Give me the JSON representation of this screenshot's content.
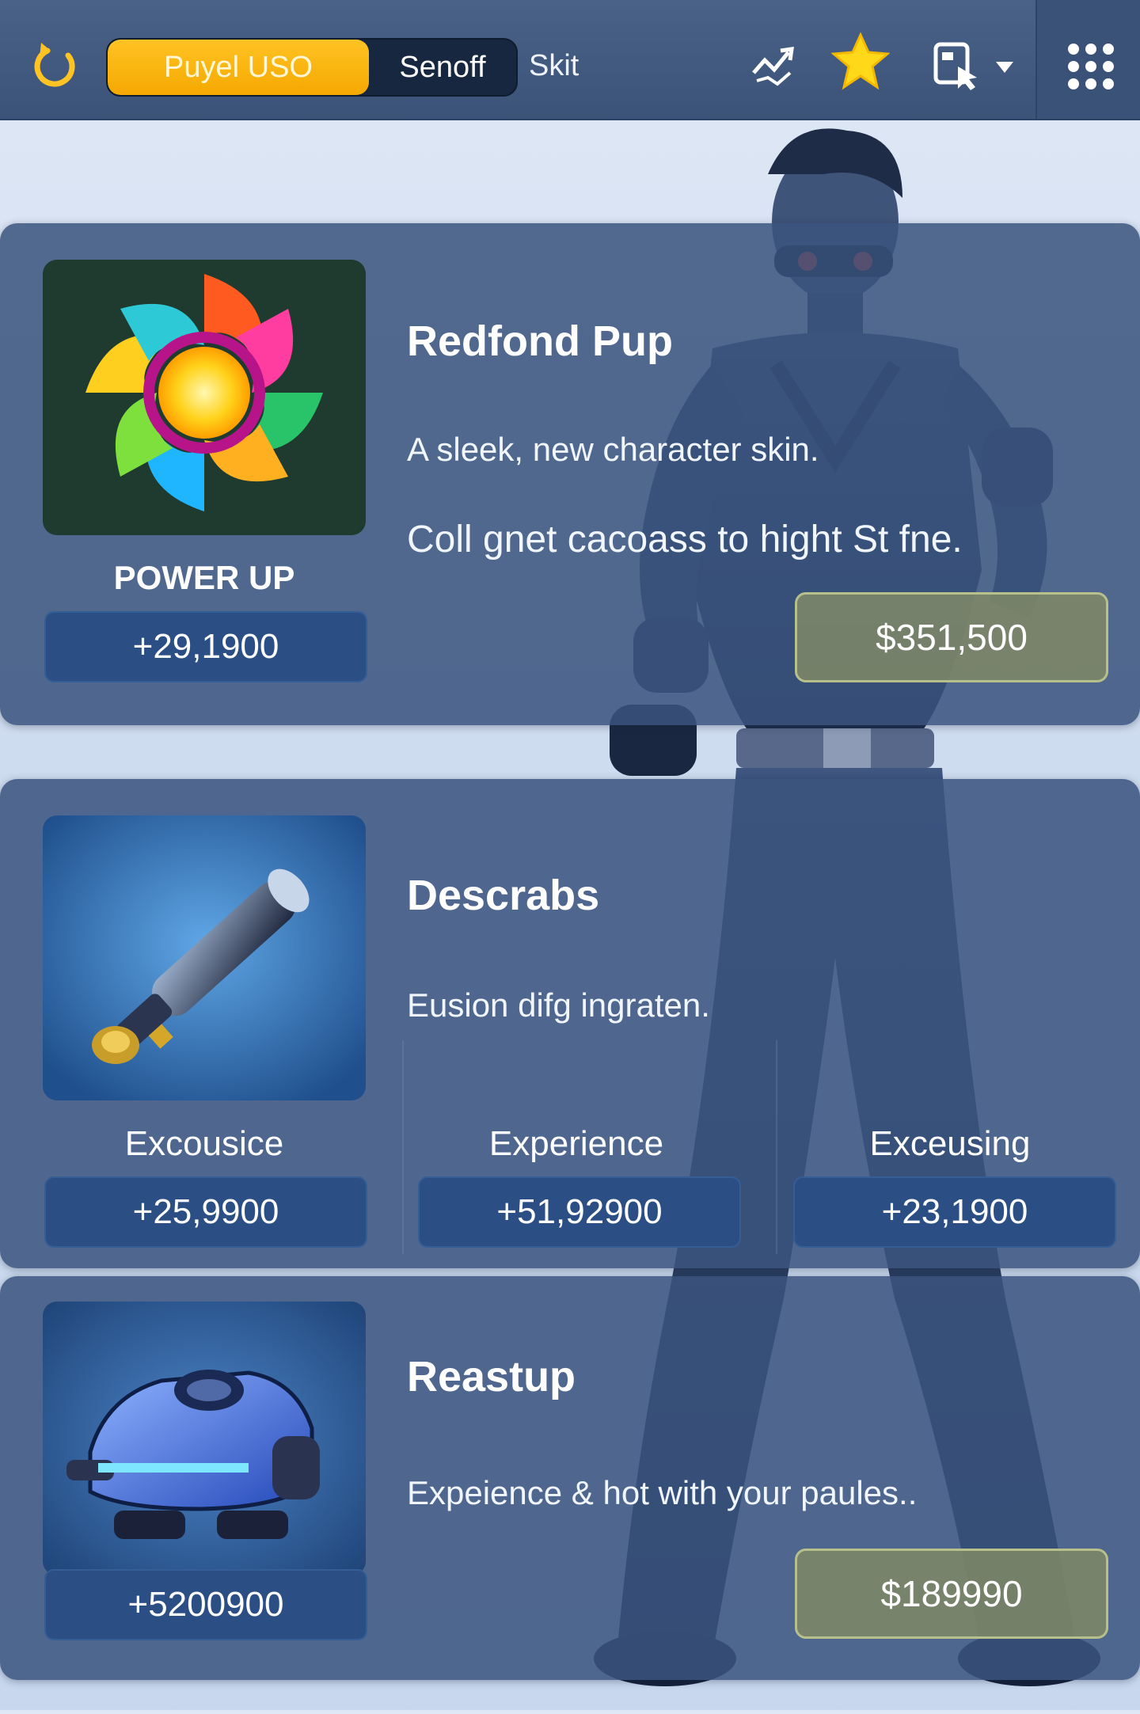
{
  "topbar": {
    "tabs": [
      {
        "label": "Puyel USO",
        "active": true
      },
      {
        "label": "Senoff",
        "active": false
      }
    ],
    "free_tab": "Skit",
    "icons": [
      "refresh-icon",
      "shuffle-icon",
      "star-icon",
      "inventory-icon",
      "chevron-down-icon",
      "grid-menu-icon"
    ],
    "accent": "#ffc324"
  },
  "cards": [
    {
      "title": "Redfond Pup",
      "desc1": "A sleek, new character skin.",
      "desc2": "Coll gnet cacoass to hight St fne.",
      "thumb_label": "POWER UP",
      "thumb_value": "+29,1900",
      "price": "$351,500"
    },
    {
      "title": "Descrabs",
      "desc1": "Eusion difg ingraten.",
      "stats": [
        {
          "label": "Excousice",
          "value": "+25,9900"
        },
        {
          "label": "Experience",
          "value": "+51,92900"
        },
        {
          "label": "Exceusing",
          "value": "+23,1900"
        }
      ]
    },
    {
      "title": "Reastup",
      "desc1": "Expeience & hot with your paules..",
      "thumb_value": "+5200900",
      "price": "$189990"
    }
  ],
  "colors": {
    "card_bg": "#3a547e",
    "pill_bg": "#2b4f85",
    "price_bg": "#7e8868",
    "hero_eyes": "#ff3b1f"
  }
}
